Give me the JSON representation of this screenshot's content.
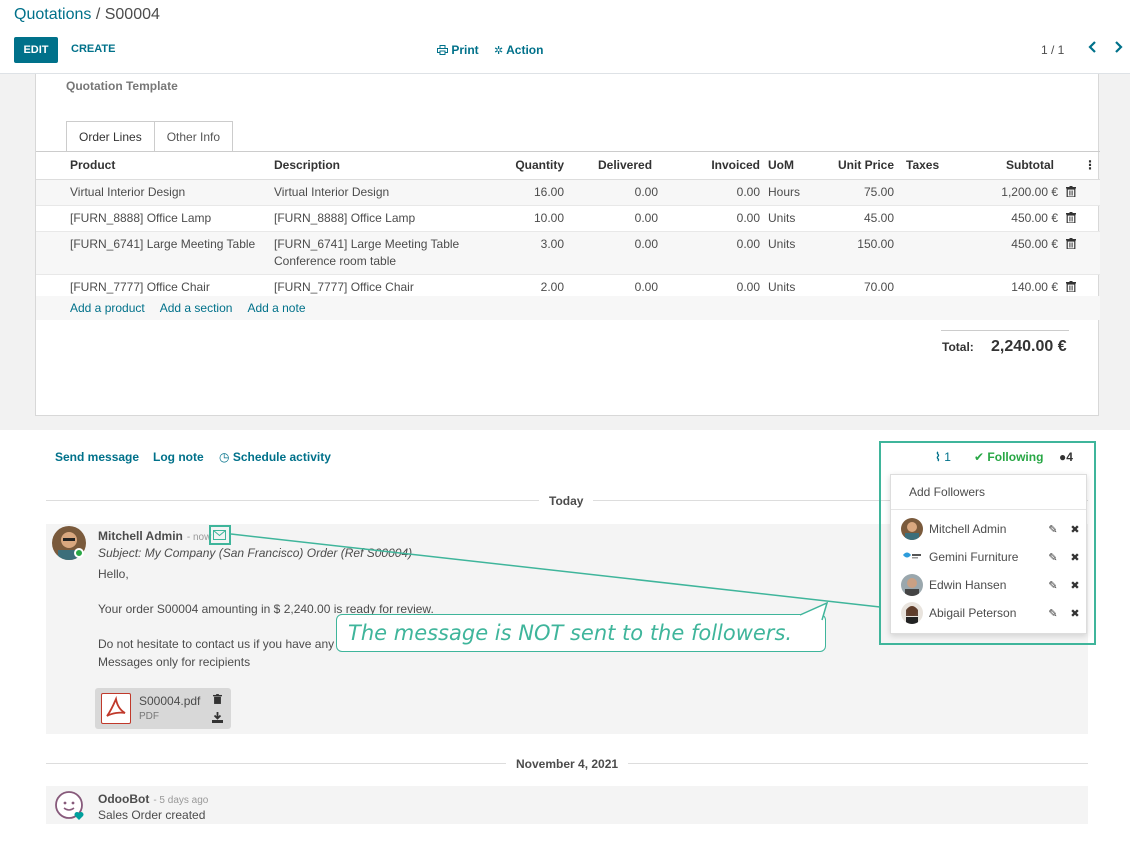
{
  "breadcrumb": {
    "parent": "Quotations",
    "separator": " / ",
    "current": "S00004"
  },
  "toolbar": {
    "edit": "EDIT",
    "create": "CREATE",
    "print": "Print",
    "action": "Action",
    "pager": "1 / 1"
  },
  "form": {
    "template_label": "Quotation Template",
    "tabs": [
      "Order Lines",
      "Other Info"
    ],
    "columns": [
      "Product",
      "Description",
      "Quantity",
      "Delivered",
      "Invoiced",
      "UoM",
      "Unit Price",
      "Taxes",
      "Subtotal"
    ],
    "lines": [
      {
        "product": "Virtual Interior Design",
        "description": "Virtual Interior Design",
        "description2": "",
        "quantity": "16.00",
        "delivered": "0.00",
        "invoiced": "0.00",
        "uom": "Hours",
        "unit_price": "75.00",
        "taxes": "",
        "subtotal": "1,200.00 €"
      },
      {
        "product": "[FURN_8888] Office Lamp",
        "description": "[FURN_8888] Office Lamp",
        "description2": "",
        "quantity": "10.00",
        "delivered": "0.00",
        "invoiced": "0.00",
        "uom": "Units",
        "unit_price": "45.00",
        "taxes": "",
        "subtotal": "450.00 €"
      },
      {
        "product": "[FURN_6741] Large Meeting Table",
        "description": "[FURN_6741] Large Meeting Table",
        "description2": "Conference room table",
        "quantity": "3.00",
        "delivered": "0.00",
        "invoiced": "0.00",
        "uom": "Units",
        "unit_price": "150.00",
        "taxes": "",
        "subtotal": "450.00 €"
      },
      {
        "product": "[FURN_7777] Office Chair",
        "description": "[FURN_7777] Office Chair",
        "description2": "",
        "quantity": "2.00",
        "delivered": "0.00",
        "invoiced": "0.00",
        "uom": "Units",
        "unit_price": "70.00",
        "taxes": "",
        "subtotal": "140.00 €"
      }
    ],
    "add_links": [
      "Add a product",
      "Add a section",
      "Add a note"
    ],
    "total_label": "Total:",
    "total_value": "2,240.00 €"
  },
  "chatter": {
    "send_message": "Send message",
    "log_note": "Log note",
    "schedule_activity": "Schedule activity",
    "attachments_count": "1",
    "following": "Following",
    "followers_count": "4",
    "day_today": "Today",
    "day_older": "November 4, 2021",
    "message": {
      "author": "Mitchell Admin",
      "when": "- now",
      "subject": "Subject: My Company (San Francisco) Order (Ref S00004)",
      "greeting": "Hello,",
      "body1": "Your order S00004 amounting in $ 2,240.00 is ready for review.",
      "body2": "Do not hesitate to contact us if you have any",
      "body3": "Messages only for recipients",
      "attachment_name": "S00004.pdf",
      "attachment_type": "PDF"
    },
    "bot_message": {
      "author": "OdooBot",
      "when": "- 5 days ago",
      "text": "Sales Order created"
    }
  },
  "followers_dropdown": {
    "add_followers": "Add Followers",
    "followers": [
      "Mitchell Admin",
      "Gemini Furniture",
      "Edwin Hansen",
      "Abigail Peterson"
    ]
  },
  "callout": {
    "text": "The message is NOT sent to the followers."
  },
  "colors": {
    "primary": "#00718a",
    "highlight": "#3fb59b",
    "pdf_red": "#c0392b"
  }
}
